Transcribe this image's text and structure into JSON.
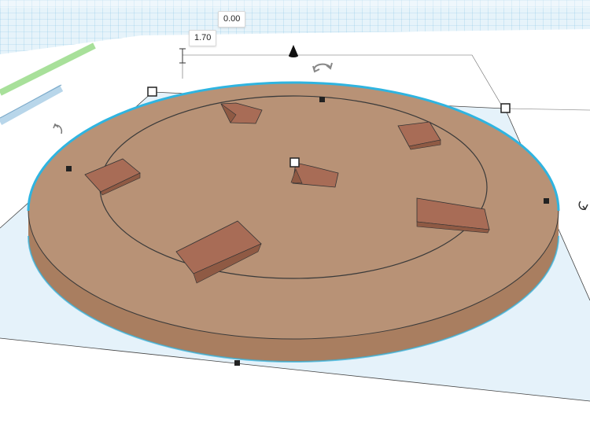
{
  "viewport": {
    "grid_color": "#4aa8d8",
    "workplane_bg": "#e8f4fa",
    "shadow_color": "#cfe8f6",
    "selection_outline_color": "#2fb4e0"
  },
  "object": {
    "top_color": "#b89276",
    "side_color": "#a97e60",
    "block_color": "#a86c56"
  },
  "dimensions": {
    "top_elevation": "0.00",
    "height": "1.70"
  },
  "icons": [
    "cone-move-icon",
    "rotate-arrow-icon",
    "rotate-arrow-icon",
    "rotate-arrow-icon"
  ]
}
